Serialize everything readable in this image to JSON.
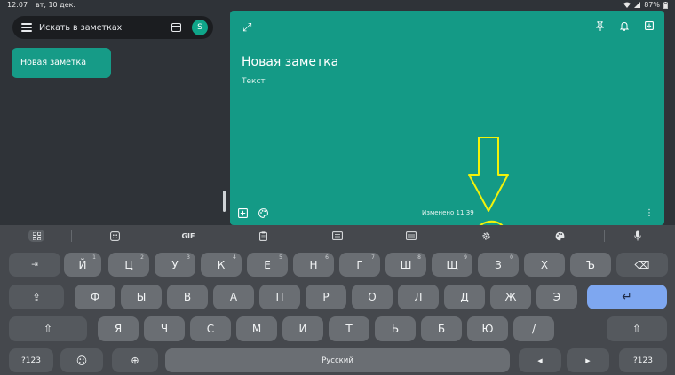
{
  "status": {
    "time": "12:07",
    "date": "вт, 10 дек.",
    "battery": "87%"
  },
  "search": {
    "label": "Искать в заметках",
    "avatar": "S"
  },
  "notes": [
    {
      "title": "Новая заметка"
    }
  ],
  "editor": {
    "title": "Новая заметка",
    "placeholder": "Текст",
    "edited": "Изменено 11:39"
  },
  "toolbar": {
    "gif": "GIF"
  },
  "rows": [
    {
      "keys": [
        {
          "l": "⇥"
        },
        {
          "l": "Й",
          "s": "1"
        },
        {
          "l": "Ц",
          "s": "2"
        },
        {
          "l": "У",
          "s": "3"
        },
        {
          "l": "К",
          "s": "4"
        },
        {
          "l": "Е",
          "s": "5"
        },
        {
          "l": "Н",
          "s": "6"
        },
        {
          "l": "Г",
          "s": "7"
        },
        {
          "l": "Ш",
          "s": "8"
        },
        {
          "l": "Щ",
          "s": "9"
        },
        {
          "l": "З",
          "s": "0"
        },
        {
          "l": "Х"
        },
        {
          "l": "Ъ"
        },
        {
          "l": "⌫"
        }
      ]
    },
    {
      "keys": [
        {
          "l": "⇪"
        },
        {
          "l": "Ф"
        },
        {
          "l": "Ы"
        },
        {
          "l": "В"
        },
        {
          "l": "А"
        },
        {
          "l": "П"
        },
        {
          "l": "Р"
        },
        {
          "l": "О"
        },
        {
          "l": "Л"
        },
        {
          "l": "Д"
        },
        {
          "l": "Ж"
        },
        {
          "l": "Э"
        },
        {
          "l": "↵"
        }
      ]
    },
    {
      "keys": [
        {
          "l": "⇧"
        },
        {
          "l": "Я"
        },
        {
          "l": "Ч"
        },
        {
          "l": "С"
        },
        {
          "l": "М"
        },
        {
          "l": "И"
        },
        {
          "l": "Т"
        },
        {
          "l": "Ь"
        },
        {
          "l": "Б"
        },
        {
          "l": "Ю"
        },
        {
          "l": "/"
        },
        {
          "l": "⇧"
        }
      ]
    },
    {
      "keys": [
        {
          "l": "?123"
        },
        {
          "l": "☺"
        },
        {
          "l": "⊕"
        },
        {
          "l": "Русский"
        },
        {
          "l": "◀"
        },
        {
          "l": "▶"
        },
        {
          "l": "?123"
        }
      ]
    }
  ],
  "colors": {
    "note": "#149a86",
    "keyboard": "#45484d",
    "key": "#6a6e73",
    "enter": "#7ea7f0",
    "annotation": "#f2f20a"
  }
}
